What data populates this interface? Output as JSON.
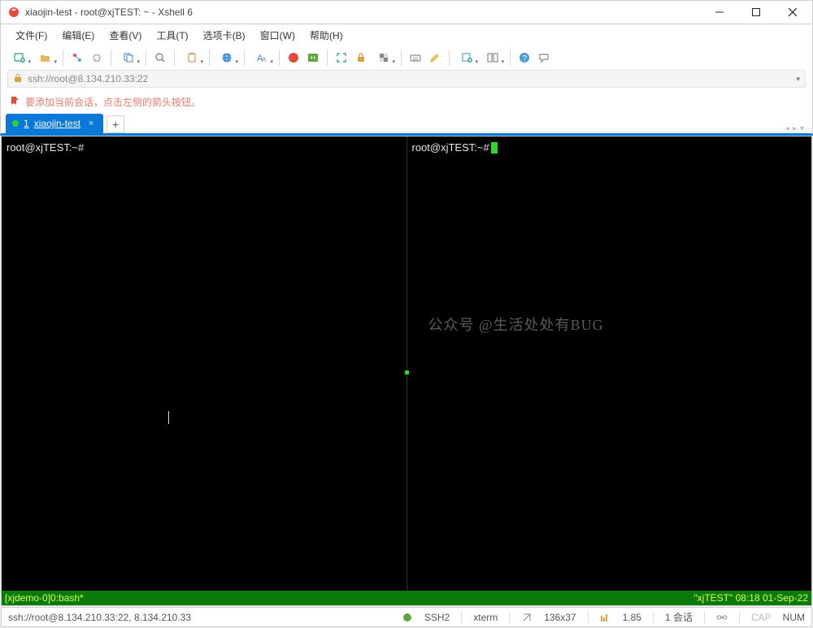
{
  "titlebar": {
    "title": "xiaojin-test - root@xjTEST: ~ - Xshell 6"
  },
  "menu": {
    "file": "文件(F)",
    "edit": "编辑(E)",
    "view": "查看(V)",
    "tools": "工具(T)",
    "tabs": "选项卡(B)",
    "window": "窗口(W)",
    "help": "帮助(H)"
  },
  "addressbar": {
    "url": "ssh://root@8.134.210.33:22"
  },
  "tipbar": {
    "text": "要添加当前会话，点击左侧的箭头按钮。"
  },
  "tabs": {
    "active_index": "1",
    "active_label": "xiaojin-test"
  },
  "terminal": {
    "left_prompt": "root@xjTEST:~#",
    "right_prompt": "root@xjTEST:~#",
    "watermark": "公众号 @生活处处有BUG",
    "tmux_left": "[xjdemo-0]0:bash*",
    "tmux_right": "\"xjTEST\" 08:18 01-Sep-22"
  },
  "status": {
    "conn": "ssh://root@8.134.210.33:22, 8.134.210.33",
    "proto": "SSH2",
    "term": "xterm",
    "size": "136x37",
    "pos": "1,85",
    "sessions": "1 会话",
    "cap": "CAP",
    "num": "NUM"
  }
}
